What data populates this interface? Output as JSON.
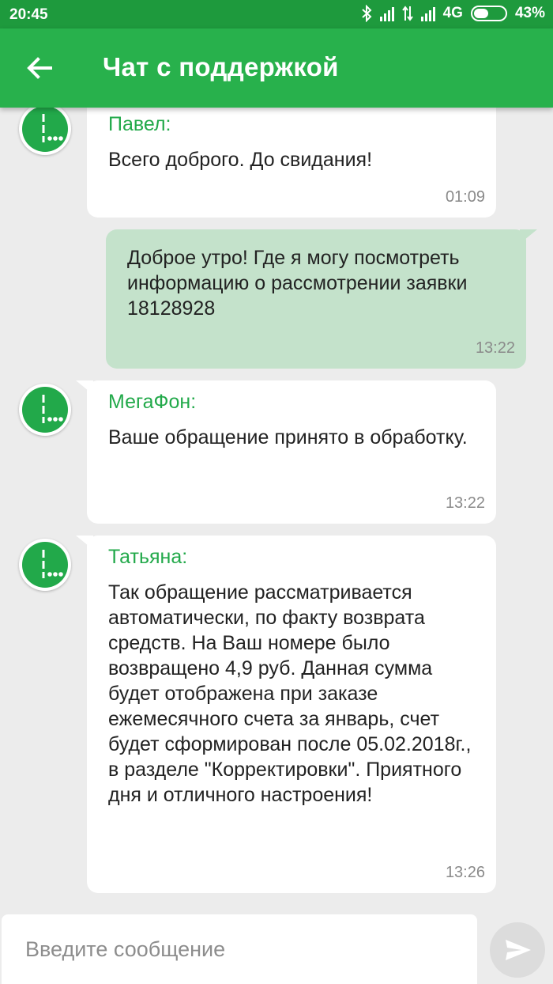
{
  "status_bar": {
    "time": "20:45",
    "network": "4G",
    "battery": "43%",
    "icons": [
      "bluetooth-icon",
      "signal-icon",
      "data-transfer-icon",
      "signal-icon",
      "battery-icon"
    ]
  },
  "app_bar": {
    "back_icon": "arrow-left-icon",
    "title": "Чат с поддержкой",
    "color": "#28b14c"
  },
  "messages": [
    {
      "direction": "incoming",
      "sender": "Павел:",
      "text": "Всего доброго. До свидания!",
      "time": "01:09"
    },
    {
      "direction": "outgoing",
      "text": "Доброе утро! Где я могу посмотреть информацию о рассмотрении заявки 18128928",
      "time": "13:22"
    },
    {
      "direction": "incoming",
      "sender": "МегаФон:",
      "text": "Ваше обращение принято в обработку.",
      "time": "13:22"
    },
    {
      "direction": "incoming",
      "sender": "Татьяна:",
      "text": "Так обращение рассматривается автоматически, по факту возврата средств. На Ваш номере было возвращено 4,9 руб. Данная сумма будет отображена при заказе ежемесячного счета за январь, счет будет сформирован после 05.02.2018г., в разделе \"Корректировки\". Приятного дня и отличного настроения!",
      "time": "13:26"
    }
  ],
  "composer": {
    "placeholder": "Введите сообщение",
    "send_icon": "send-icon"
  },
  "colors": {
    "brand_green": "#28b14c",
    "status_bar": "#1e9a3d",
    "outgoing_bubble": "#c4e2cb",
    "sender_name": "#22a94a"
  }
}
